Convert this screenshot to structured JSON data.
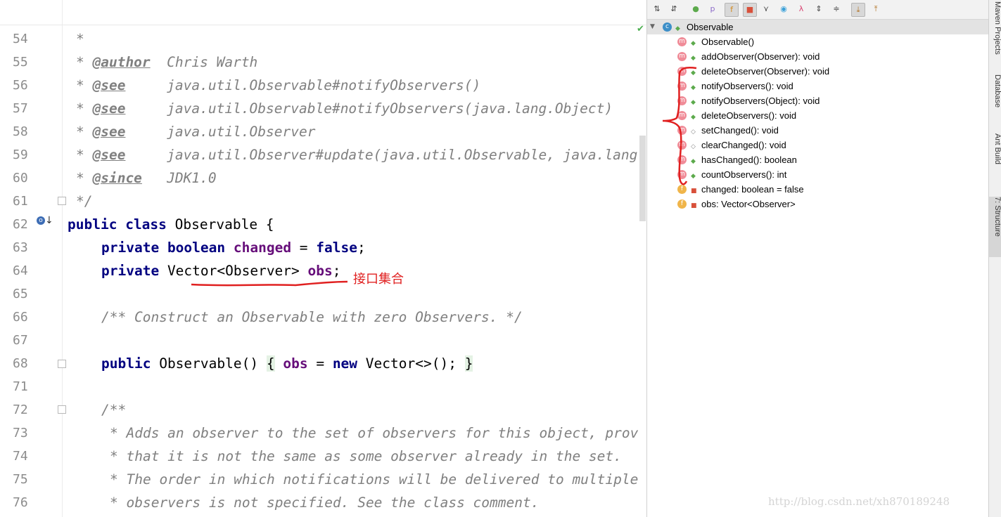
{
  "editor": {
    "lines": [
      {
        "n": "54",
        "text": "*"
      },
      {
        "n": "55",
        "tag": "@author",
        "rest": "Chris Warth"
      },
      {
        "n": "56",
        "tag": "@see",
        "rest": "java.util.Observable#notifyObservers()"
      },
      {
        "n": "57",
        "tag": "@see",
        "rest": "java.util.Observable#notifyObservers(java.lang.Object)"
      },
      {
        "n": "58",
        "tag": "@see",
        "rest": "java.util.Observer"
      },
      {
        "n": "59",
        "tag": "@see",
        "rest": "java.util.Observer#update(java.util.Observable, java.lang"
      },
      {
        "n": "60",
        "tag": "@since",
        "rest": "JDK1.0"
      },
      {
        "n": "61",
        "text": "*/"
      },
      {
        "n": "62"
      },
      {
        "n": "63"
      },
      {
        "n": "64"
      },
      {
        "n": "65"
      },
      {
        "n": "66",
        "text": "/** Construct an Observable with zero Observers. */"
      },
      {
        "n": "67"
      },
      {
        "n": "68"
      },
      {
        "n": "71"
      },
      {
        "n": "72",
        "text": "/**"
      },
      {
        "n": "73",
        "text": "* Adds an observer to the set of observers for this object, prov"
      },
      {
        "n": "74",
        "text": "* that it is not the same as some observer already in the set."
      },
      {
        "n": "75",
        "text": "* The order in which notifications will be delivered to multiple"
      },
      {
        "n": "76",
        "text": "* observers is not specified. See the class comment."
      }
    ],
    "kw_public": "public",
    "kw_class": "class",
    "class_name": "Observable {",
    "kw_private": "private",
    "kw_boolean": "boolean",
    "field_changed": "changed",
    "assign": " = ",
    "kw_false": "false",
    "semi": ";",
    "vector_type": "Vector<Observer>",
    "field_obs": "obs",
    "ctor_name": "Observable()",
    "brace_open": "{",
    "kw_new": "new",
    "new_expr": "Vector<>();",
    "brace_close": "}",
    "annotation": "接口集合"
  },
  "structure": {
    "root": "Observable",
    "items": [
      {
        "kind": "m",
        "vis": "pub",
        "label": "Observable()"
      },
      {
        "kind": "m",
        "vis": "pub",
        "label": "addObserver(Observer): void"
      },
      {
        "kind": "m",
        "vis": "pub",
        "label": "deleteObserver(Observer): void"
      },
      {
        "kind": "m",
        "vis": "pub",
        "label": "notifyObservers(): void"
      },
      {
        "kind": "m",
        "vis": "pub",
        "label": "notifyObservers(Object): void"
      },
      {
        "kind": "m",
        "vis": "pub",
        "label": "deleteObservers(): void"
      },
      {
        "kind": "m",
        "vis": "pkg",
        "label": "setChanged(): void"
      },
      {
        "kind": "m",
        "vis": "pkg",
        "label": "clearChanged(): void"
      },
      {
        "kind": "m",
        "vis": "pub",
        "label": "hasChanged(): boolean"
      },
      {
        "kind": "m",
        "vis": "pub",
        "label": "countObservers(): int"
      },
      {
        "kind": "f",
        "vis": "priv",
        "label": "changed: boolean = false"
      },
      {
        "kind": "f",
        "vis": "priv",
        "label": "obs: Vector<Observer>"
      }
    ]
  },
  "side_tabs": [
    "Maven Projects",
    "Database",
    "Ant Build",
    "7: Structure"
  ],
  "watermark": "http://blog.csdn.net/xh870189248",
  "colors": {
    "keyword": "#000080",
    "field": "#660e7a",
    "comment": "#808080",
    "annotation": "#e02020"
  }
}
